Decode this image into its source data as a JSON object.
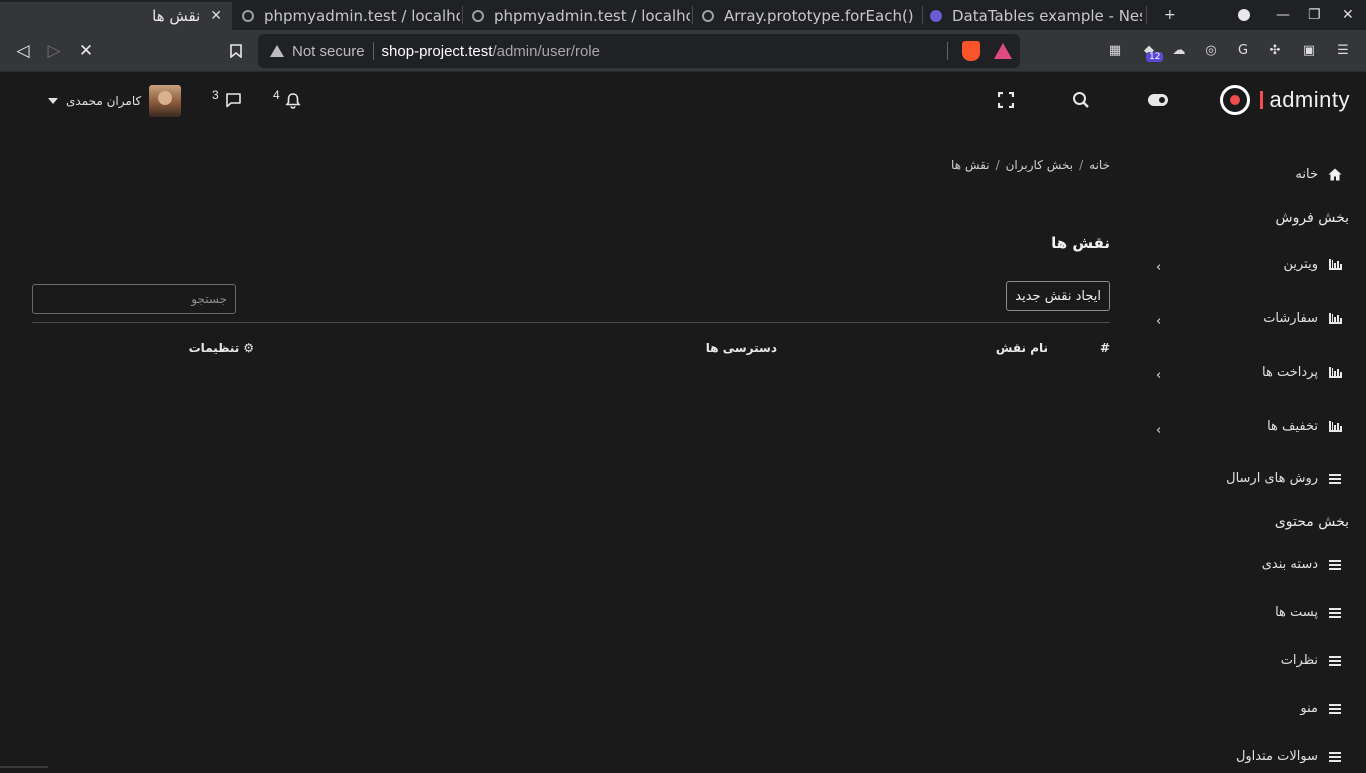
{
  "browser": {
    "tabs": [
      {
        "title": "نقش ها"
      },
      {
        "title": "phpmyadmin.test / localho"
      },
      {
        "title": "phpmyadmin.test / localhost"
      },
      {
        "title": "Array.prototype.forEach()"
      },
      {
        "title": "DataTables example - Neste"
      }
    ],
    "address": {
      "security_label": "Not secure",
      "host": "shop-project.test",
      "path": "/admin/user/role"
    },
    "extension_badge": "12"
  },
  "header": {
    "logo_text": "adminty",
    "notifications_count": "4",
    "messages_count": "3",
    "user_name": "کامران محمدی"
  },
  "sidebar": {
    "home": "خانه",
    "sales_section": "بخش فروش",
    "sales_items": [
      "ویترین",
      "سفارشات",
      "پرداخت ها",
      "تخفیف ها",
      "روش های ارسال"
    ],
    "content_section": "بخش محتوی",
    "content_items": [
      "دسته بندی",
      "پست ها",
      "نظرات",
      "منو",
      "سوالات متداول"
    ]
  },
  "content": {
    "breadcrumb": [
      "خانه",
      "بخش کاربران",
      "نقش ها"
    ],
    "title": "نقش ها",
    "new_button": "ایجاد نقش جدید",
    "search_placeholder": "جستجو",
    "columns": [
      "#",
      "نام نقش",
      "دسترسی ها",
      "تنظیمات"
    ]
  }
}
